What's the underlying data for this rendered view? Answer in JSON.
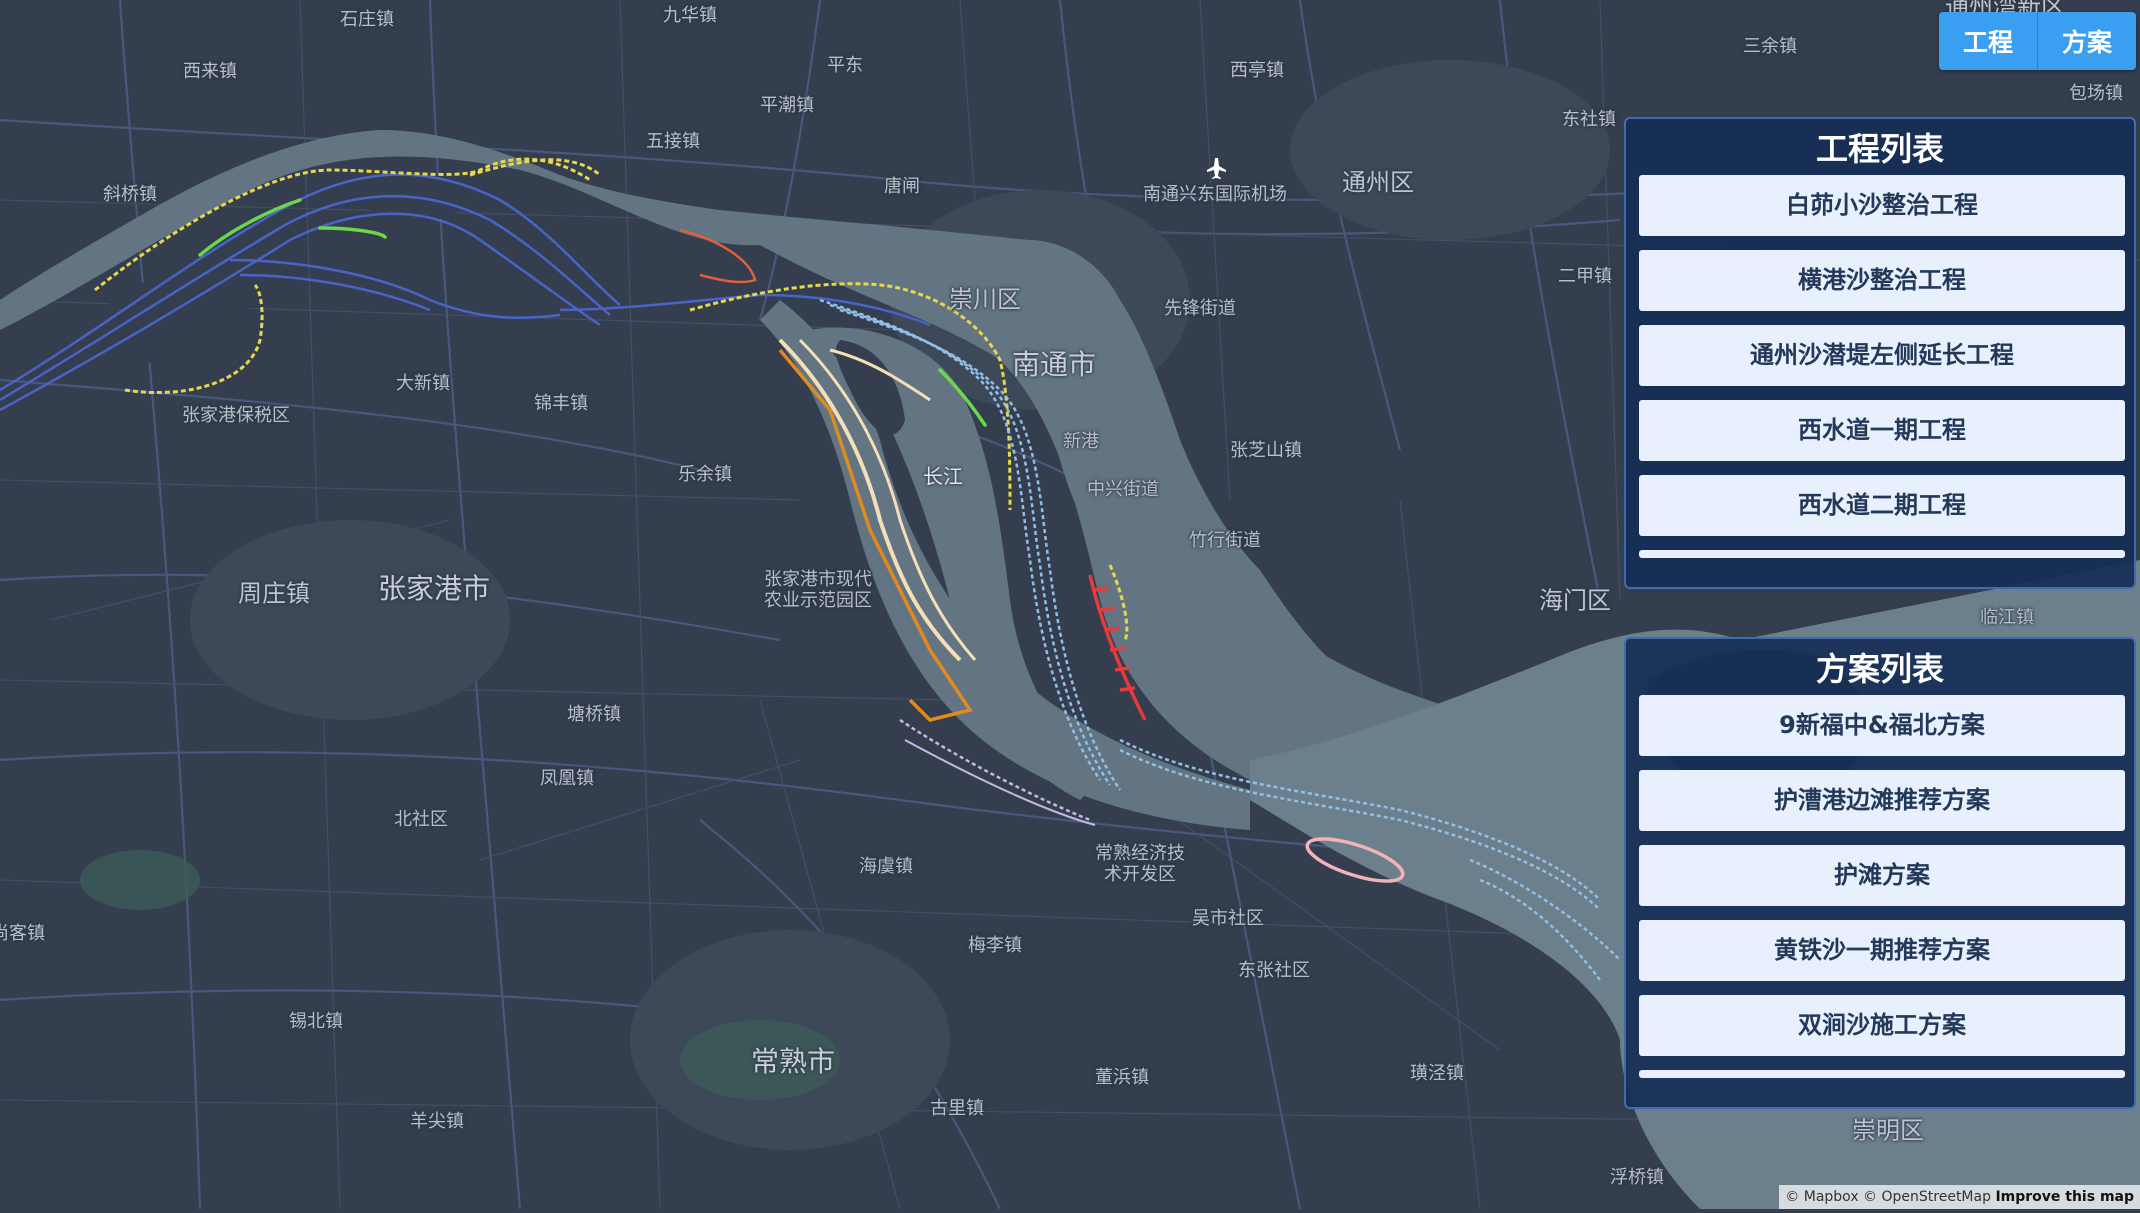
{
  "map": {
    "colors": {
      "land": "#343e4e",
      "river": "#637582",
      "river_light": "#6c7f8c",
      "road": "#4b5b80",
      "route_blue": "#4a63c8",
      "dash_yellow": "#e6d84c",
      "dash_lightblue": "#90c0e8",
      "green": "#6bd84c",
      "orange": "#e08a20",
      "red": "#e83a3a",
      "pink": "#f0b4b8",
      "cream": "#f4dfb8",
      "purple": "#c8b8e6"
    },
    "labels": {
      "shizhuang": "石庄镇",
      "jiuhua": "九华镇",
      "xilai": "西来镇",
      "pingdong": "平东",
      "xiting": "西亭镇",
      "tongzhouwanxinqu": "通州湾新区",
      "sanyu": "三余镇",
      "baochang": "包场镇",
      "pingchao": "平潮镇",
      "wujie": "五接镇",
      "dongshe": "东社镇",
      "xieqiao": "斜桥镇",
      "tangzha": "唐闸",
      "airport": "南通兴东国际机场",
      "tongzhouqu": "通州区",
      "chongchuanqu": "崇川区",
      "xianfeng": "先锋街道",
      "erjia": "二甲镇",
      "nantongshi": "南通市",
      "daxin": "大新镇",
      "zjgbaoshuiqu": "张家港保税区",
      "jinfeng": "锦丰镇",
      "xingang": "新港",
      "zhangzhishan": "张芝山镇",
      "leyu": "乐余镇",
      "changjiang": "长江",
      "zhongxing": "中兴街道",
      "zhuhang": "竹行街道",
      "zhouzhuang": "周庄镇",
      "zhangjiagangshi": "张家港市",
      "zjg_agri_line1": "张家港市现代",
      "zjg_agri_line2": "农业示范园区",
      "haimenqu": "海门区",
      "linjiang": "临江镇",
      "tangqiao": "塘桥镇",
      "fenghuang": "凤凰镇",
      "beishe": "北社区",
      "haiyu": "海虞镇",
      "changshu_eco_line1": "常熟经济技",
      "changshu_eco_line2": "术开发区",
      "wushi": "吴市社区",
      "meili": "梅李镇",
      "dongbang": "东张社区",
      "shangke": "尚客镇",
      "xibei": "锡北镇",
      "changshushi": "常熟市",
      "dongbin": "董浜镇",
      "xujing": "璜泾镇",
      "yangjian": "羊尖镇",
      "guli": "古里镇",
      "chongmingqu": "崇明区",
      "fuqiao": "浮桥镇"
    }
  },
  "toggle": {
    "engineering_label": "工程",
    "plan_label": "方案"
  },
  "engineering_list": {
    "title": "工程列表",
    "items": [
      "白茆小沙整治工程",
      "横港沙整治工程",
      "通州沙潜堤左侧延长工程",
      "西水道一期工程",
      "西水道二期工程"
    ]
  },
  "plan_list": {
    "title": "方案列表",
    "items": [
      "9新福中&福北方案",
      "护漕港边滩推荐方案",
      "护滩方案",
      "黄铁沙一期推荐方案",
      "双涧沙施工方案"
    ]
  },
  "attribution": {
    "text": "© Mapbox © OpenStreetMap",
    "improve": "Improve this map"
  }
}
